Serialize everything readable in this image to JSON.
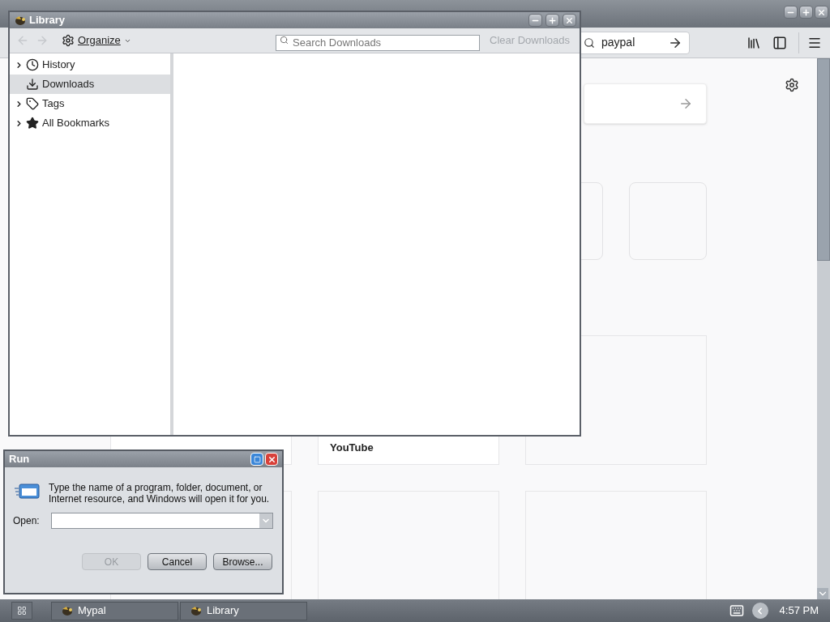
{
  "browser": {
    "url": "paypal",
    "card_title": "YouTube"
  },
  "library": {
    "title": "Library",
    "organize": "Organize",
    "search_placeholder": "Search Downloads",
    "clear": "Clear Downloads",
    "clear_disabled": true,
    "items": [
      {
        "label": "History",
        "expandable": true,
        "selected": false
      },
      {
        "label": "Downloads",
        "expandable": false,
        "selected": true
      },
      {
        "label": "Tags",
        "expandable": true,
        "selected": false
      },
      {
        "label": "All Bookmarks",
        "expandable": true,
        "selected": false
      }
    ]
  },
  "run": {
    "title": "Run",
    "message": "Type the name of a program, folder, document, or Internet resource, and Windows will open it for you.",
    "open_label": "Open:",
    "buttons": [
      {
        "label": "OK",
        "disabled": true
      },
      {
        "label": "Cancel",
        "disabled": false
      },
      {
        "label": "Browse...",
        "disabled": false
      }
    ]
  },
  "taskbar": {
    "items": [
      {
        "label": "Mypal"
      },
      {
        "label": "Library"
      }
    ],
    "clock": "4:57 PM"
  }
}
